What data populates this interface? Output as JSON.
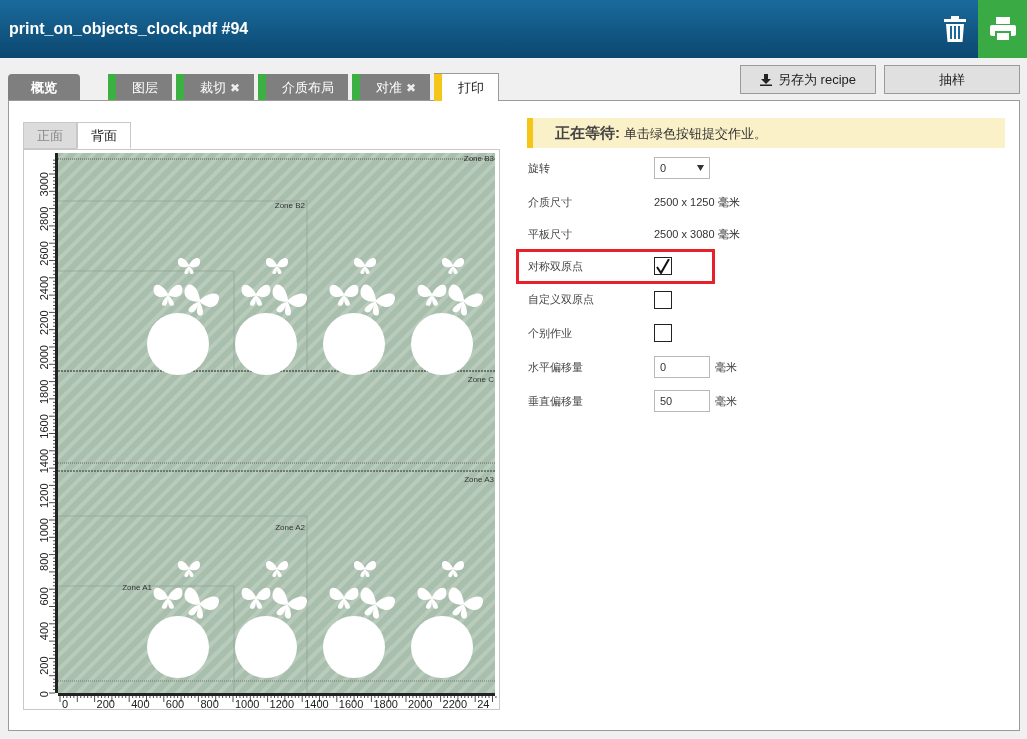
{
  "header": {
    "title": "print_on_objects_clock.pdf #94"
  },
  "tabs": [
    {
      "label": "概览",
      "kind": "summary",
      "selected": false
    },
    {
      "label": "图层",
      "kind": "step",
      "color": "#3cb043",
      "closable": false,
      "selected": false
    },
    {
      "label": "裁切",
      "kind": "step",
      "color": "#3cb043",
      "closable": true,
      "close_glyph": "✖",
      "selected": false
    },
    {
      "label": "介质布局",
      "kind": "step",
      "color": "#3cb043",
      "closable": false,
      "selected": false
    },
    {
      "label": "对准",
      "kind": "step",
      "color": "#3cb043",
      "closable": true,
      "close_glyph": "✖",
      "selected": false
    },
    {
      "label": "打印",
      "kind": "step",
      "color": "#f5c518",
      "closable": false,
      "selected": true
    }
  ],
  "actions": [
    {
      "label": "另存为 recipe",
      "kind": "download"
    },
    {
      "label": "抽样",
      "kind": "plain"
    }
  ],
  "side_tabs": [
    {
      "label": "正面",
      "selected": false
    },
    {
      "label": "背面",
      "selected": true
    }
  ],
  "preview": {
    "y_ruler": [
      "0",
      "200",
      "400",
      "600",
      "800",
      "1000",
      "1200",
      "1400",
      "1600",
      "1800",
      "2000",
      "2200",
      "2400",
      "2600",
      "2800",
      "3000"
    ],
    "x_ruler": [
      "0",
      "200",
      "400",
      "600",
      "800",
      "1000",
      "1200",
      "1400",
      "1600",
      "1800",
      "2000",
      "2200",
      "24"
    ],
    "zone_labels": [
      "Zone B3",
      "Zone B2",
      "Zone C",
      "Zone A3",
      "Zone A2",
      "Zone A1"
    ]
  },
  "status": {
    "text": "**正在等待:** 单击绿色按钮提交作业。"
  },
  "settings": [
    {
      "label": "旋转",
      "kind": "select",
      "value": "0"
    },
    {
      "label": "介质尺寸",
      "kind": "text",
      "value": "2500 x 1250 毫米"
    },
    {
      "label": "平板尺寸",
      "kind": "text",
      "value": "2500 x 3080 毫米"
    },
    {
      "label": "对称双原点",
      "kind": "checkbox",
      "checked": true,
      "highlighted": true
    },
    {
      "label": "自定义双原点",
      "kind": "checkbox",
      "checked": false,
      "highlighted": false
    },
    {
      "label": "个别作业",
      "kind": "checkbox",
      "checked": false,
      "highlighted": false
    },
    {
      "label": "水平偏移量",
      "kind": "input",
      "value": "0",
      "unit": "毫米"
    },
    {
      "label": "垂直偏移量",
      "kind": "input",
      "value": "50",
      "unit": "毫米"
    }
  ]
}
